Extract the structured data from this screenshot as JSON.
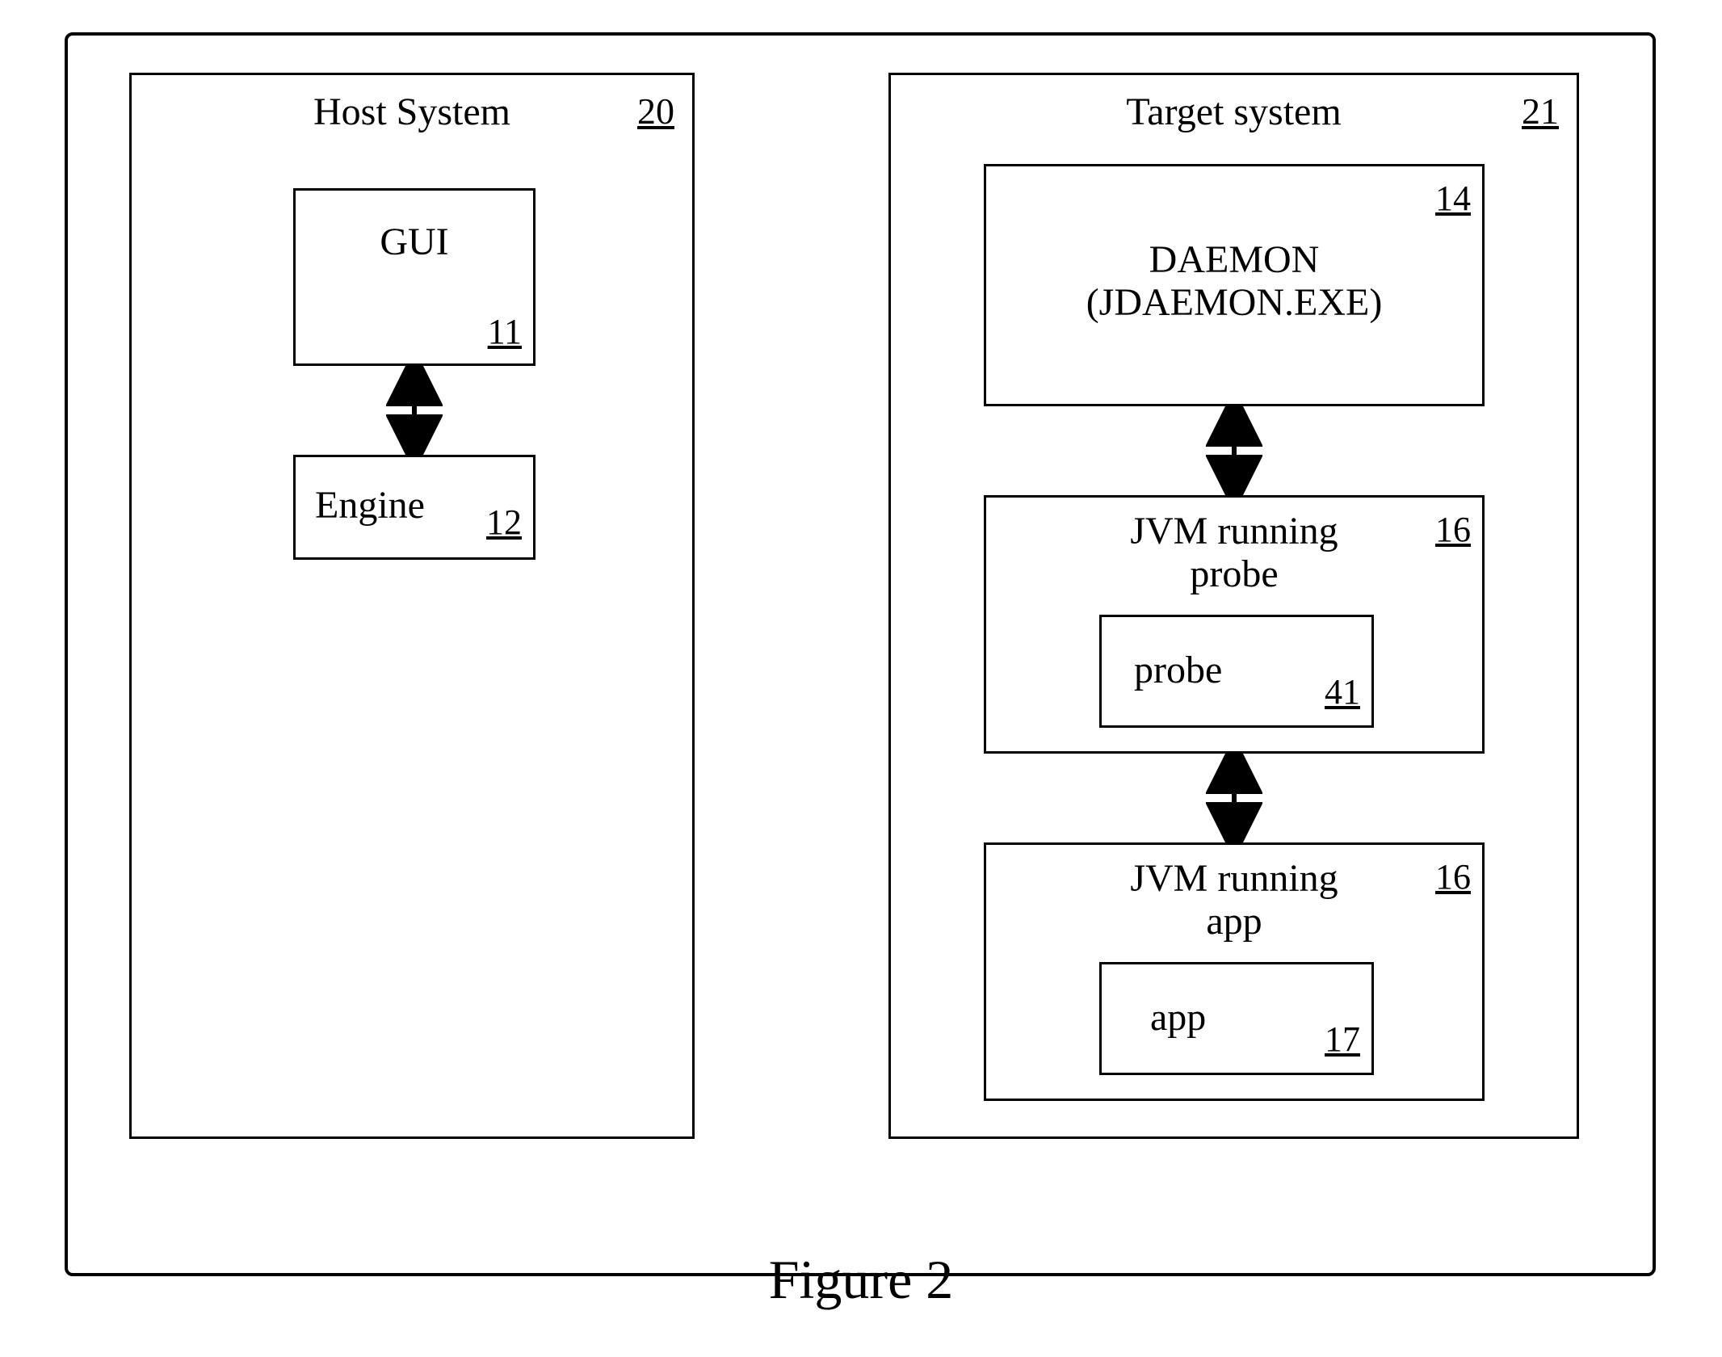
{
  "host": {
    "title": "Host System",
    "ref": "20",
    "gui": {
      "label": "GUI",
      "ref": "11"
    },
    "engine": {
      "label": "Engine",
      "ref": "12"
    }
  },
  "target": {
    "title": "Target system",
    "ref": "21",
    "daemon": {
      "line1": "DAEMON",
      "line2": "(JDAEMON.EXE)",
      "ref": "14"
    },
    "jvm_probe": {
      "line1": "JVM running",
      "line2": "probe",
      "ref": "16",
      "inner": {
        "label": "probe",
        "ref": "41"
      }
    },
    "jvm_app": {
      "line1": "JVM running",
      "line2": "app",
      "ref": "16",
      "inner": {
        "label": "app",
        "ref": "17"
      }
    }
  },
  "figure": "Figure 2"
}
